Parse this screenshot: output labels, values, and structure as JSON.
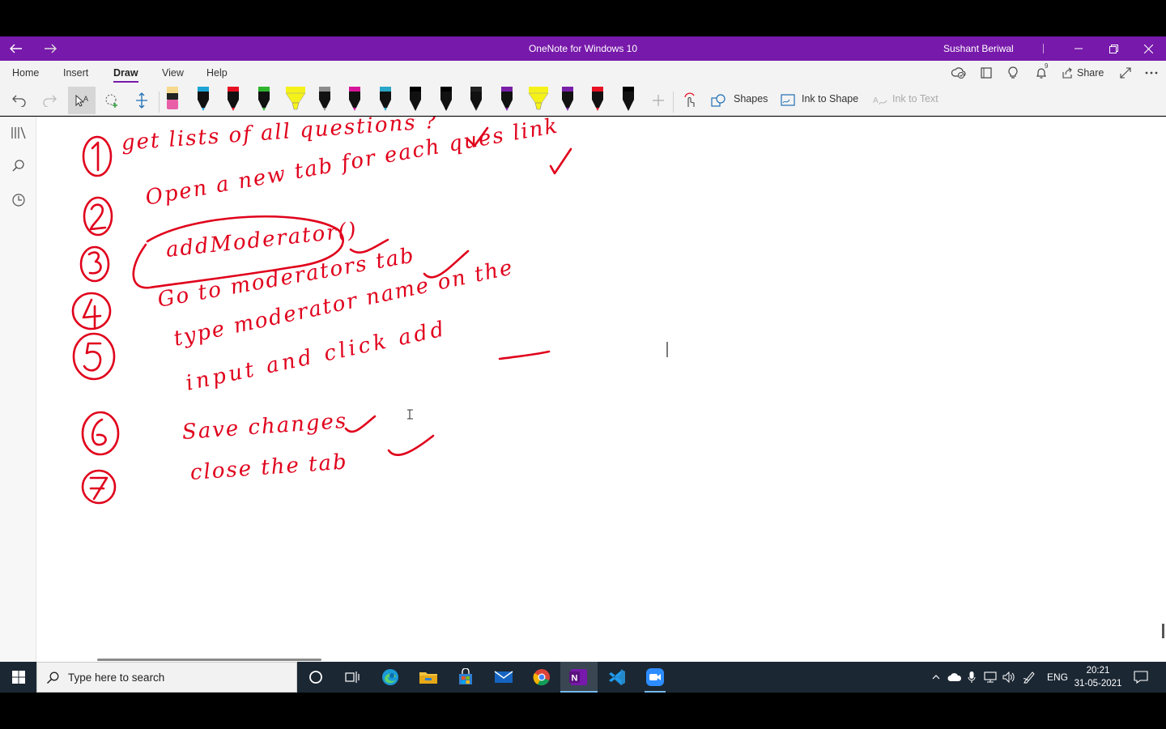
{
  "window": {
    "title": "OneNote for Windows 10",
    "user": "Sushant Beriwal",
    "accent": "#7719aa"
  },
  "ribbon": {
    "tabs": [
      {
        "label": "Home",
        "active": false
      },
      {
        "label": "Insert",
        "active": false
      },
      {
        "label": "Draw",
        "active": true
      },
      {
        "label": "View",
        "active": false
      },
      {
        "label": "Help",
        "active": false
      }
    ],
    "share_label": "Share",
    "notification_count": "9",
    "tools": {
      "shapes_label": "Shapes",
      "ink_to_shape_label": "Ink to Shape",
      "ink_to_text_label": "Ink to Text"
    },
    "pens": [
      {
        "kind": "eraser",
        "color": "#e85fa8"
      },
      {
        "kind": "pen",
        "color": "#1fa3d6"
      },
      {
        "kind": "pen",
        "color": "#e81123"
      },
      {
        "kind": "pen",
        "color": "#2db52d"
      },
      {
        "kind": "highlighter",
        "color": "#f5f21a"
      },
      {
        "kind": "pen",
        "color": "#8c8c8c"
      },
      {
        "kind": "pen",
        "color": "#d6169a"
      },
      {
        "kind": "pen",
        "color": "#2aa6c8"
      },
      {
        "kind": "pen",
        "color": "#000000"
      },
      {
        "kind": "pen",
        "color": "#000000"
      },
      {
        "kind": "pen",
        "color": "#222222"
      },
      {
        "kind": "pen",
        "color": "#7a1fa8"
      },
      {
        "kind": "highlighter",
        "color": "#f5f21a"
      },
      {
        "kind": "pen",
        "color": "#7a1fa8"
      },
      {
        "kind": "pen",
        "color": "#e81123"
      },
      {
        "kind": "pen",
        "color": "#000000"
      }
    ]
  },
  "notes": {
    "ink_color": "#e0001b",
    "items": [
      {
        "number": "1",
        "text": "get lists of all questions ?",
        "checked": true
      },
      {
        "number": "2",
        "text": "Open a new tab for each ques link",
        "checked": true
      },
      {
        "number": "3",
        "text": "addModerator()",
        "checked": true
      },
      {
        "number": "4",
        "text": "Go to moderators tab",
        "checked": true
      },
      {
        "number": "5",
        "text": "type moderator name on the",
        "continuation": "input and click add",
        "checked": false
      },
      {
        "number": "6",
        "text": "Save changes",
        "checked": true
      },
      {
        "number": "7",
        "text": "close the tab",
        "checked": true
      }
    ]
  },
  "taskbar": {
    "search_placeholder": "Type here to search",
    "language": "ENG",
    "time": "20:21",
    "date": "31-05-2021"
  }
}
